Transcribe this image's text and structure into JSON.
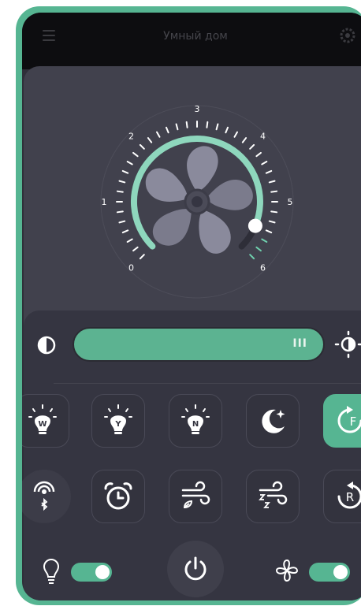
{
  "app": {
    "title": "Умный дом"
  },
  "dial": {
    "marks": [
      "0",
      "1",
      "2",
      "3",
      "4",
      "5",
      "6"
    ],
    "speed_level": 5.5,
    "max_level": 6
  },
  "brightness": {
    "level_percent": 100,
    "grip_label": "III"
  },
  "mode_buttons": [
    {
      "label": "W",
      "icon": "bulb-warm-icon"
    },
    {
      "label": "Y",
      "icon": "bulb-yellow-icon"
    },
    {
      "label": "N",
      "icon": "bulb-neutral-icon"
    },
    {
      "label": "",
      "icon": "moon-icon"
    },
    {
      "label": "F",
      "icon": "rotate-forward-icon",
      "active": true
    }
  ],
  "function_buttons": [
    {
      "icon": "bluetooth-signal-icon"
    },
    {
      "icon": "alarm-clock-icon"
    },
    {
      "icon": "natural-wind-icon"
    },
    {
      "icon": "sleep-wind-icon"
    },
    {
      "label": "R",
      "icon": "rotate-reverse-icon"
    }
  ],
  "bottom_bar": {
    "light_toggle_on": true,
    "fan_toggle_on": true
  },
  "colors": {
    "accent": "#56b592",
    "background": "#2f2f39",
    "card": "#41414d",
    "panel": "#353541"
  }
}
